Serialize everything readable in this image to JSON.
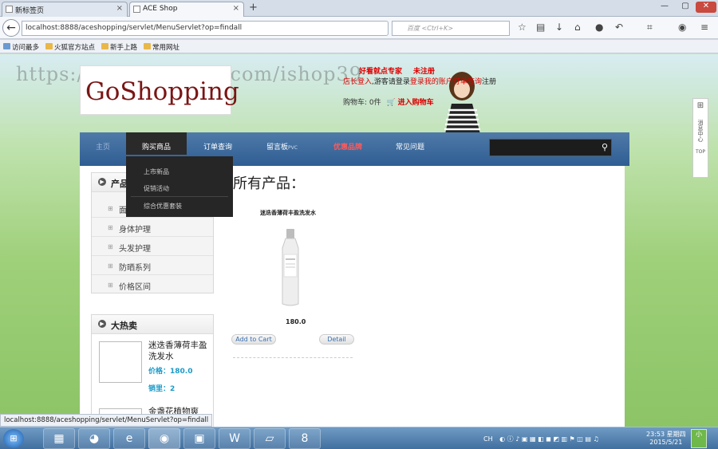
{
  "browser": {
    "tabs": [
      {
        "label": "新标签页"
      },
      {
        "label": "ACE Shop"
      }
    ],
    "url": "localhost:8888/aceshopping/servlet/MenuServlet?op=findall",
    "search_placeholder": "百度 <Ctrl+K>",
    "bookmarks": [
      "访问最多",
      "火狐官方站点",
      "新手上路",
      "常用网址"
    ],
    "status_url": "localhost:8888/aceshopping/servlet/MenuServlet?op=findall"
  },
  "watermark": "https://www.huzhan.com/ishop39",
  "site": {
    "logo": "GoShopping",
    "toplinks": {
      "shop_login": "店长登入",
      "guest_prefix": "游客请登录",
      "login_link": "登录",
      "my_orders": "我的账户",
      "order_query": "订单查询",
      "register": "注册",
      "promo": "好看就点专家",
      "unreg": "未注册"
    },
    "cart_label": "购物车: 0件",
    "cart_link": "进入购物车"
  },
  "menu": {
    "items": [
      "主页",
      "购买商品",
      "订单查询",
      "留言板",
      "优惠品牌",
      "常见问题"
    ],
    "pvc": "PVC",
    "dropdown": [
      "上市新品",
      "促销活动",
      "综合优惠套装"
    ]
  },
  "sidebar": {
    "categories_title": "产品",
    "categories": [
      "面部护理",
      "身体护理",
      "头发护理",
      "防晒系列",
      "价格区间"
    ],
    "hot_title": "大热卖",
    "hot": [
      {
        "name": "迷迭香薄荷丰盈洗发水",
        "price_label": "价格：",
        "price": "180.0",
        "sales_label": "销里：",
        "sales": "2"
      },
      {
        "name": "金盏花植物爽"
      }
    ]
  },
  "main": {
    "title": "所有产品：",
    "products": [
      {
        "name": "迷迭香薄荷丰盈洗发水",
        "price": "180.0",
        "add_label": "Add to Cart",
        "detail_label": "Detail"
      }
    ]
  },
  "sidepanel": {
    "label": "消息中心",
    "top": "TOP"
  },
  "taskbar": {
    "time": "23:53 星期四",
    "date": "2015/5/21",
    "lang": "CH"
  }
}
